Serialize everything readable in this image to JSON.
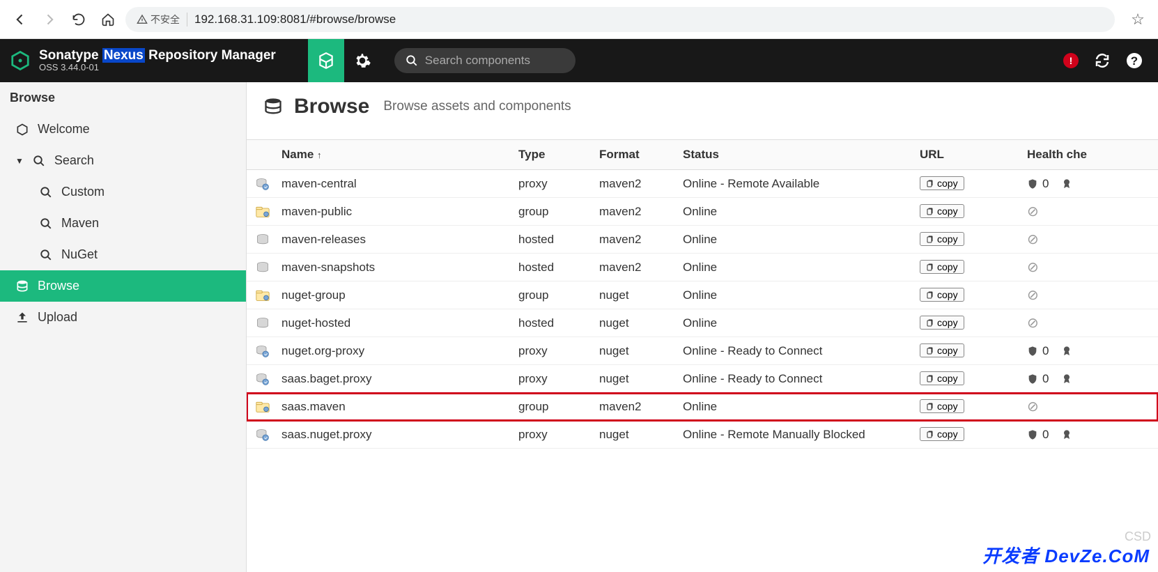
{
  "browser": {
    "insecure_label": "不安全",
    "url": "192.168.31.109:8081/#browse/browse"
  },
  "header": {
    "brand_pre": "Sonatype ",
    "brand_hl": "Nexus",
    "brand_post": " Repository Manager",
    "version": "OSS 3.44.0-01",
    "search_placeholder": "Search components"
  },
  "sidebar": {
    "header": "Browse",
    "items": [
      {
        "label": "Welcome",
        "icon": "hex"
      },
      {
        "label": "Search",
        "icon": "search",
        "caret": true
      },
      {
        "label": "Custom",
        "icon": "search",
        "indent": true
      },
      {
        "label": "Maven",
        "icon": "search",
        "indent": true
      },
      {
        "label": "NuGet",
        "icon": "search",
        "indent": true
      },
      {
        "label": "Browse",
        "icon": "db",
        "active": true
      },
      {
        "label": "Upload",
        "icon": "upload"
      }
    ]
  },
  "content": {
    "title": "Browse",
    "subtitle": "Browse assets and components"
  },
  "columns": {
    "name": "Name",
    "type": "Type",
    "format": "Format",
    "status": "Status",
    "url": "URL",
    "health": "Health che"
  },
  "copy_label": "copy",
  "rows": [
    {
      "name": "maven-central",
      "type": "proxy",
      "format": "maven2",
      "status": "Online - Remote Available",
      "kind": "proxy",
      "health": "shield0medal"
    },
    {
      "name": "maven-public",
      "type": "group",
      "format": "maven2",
      "status": "Online",
      "kind": "group",
      "health": "ban"
    },
    {
      "name": "maven-releases",
      "type": "hosted",
      "format": "maven2",
      "status": "Online",
      "kind": "hosted",
      "health": "ban"
    },
    {
      "name": "maven-snapshots",
      "type": "hosted",
      "format": "maven2",
      "status": "Online",
      "kind": "hosted",
      "health": "ban"
    },
    {
      "name": "nuget-group",
      "type": "group",
      "format": "nuget",
      "status": "Online",
      "kind": "group",
      "health": "ban"
    },
    {
      "name": "nuget-hosted",
      "type": "hosted",
      "format": "nuget",
      "status": "Online",
      "kind": "hosted",
      "health": "ban"
    },
    {
      "name": "nuget.org-proxy",
      "type": "proxy",
      "format": "nuget",
      "status": "Online - Ready to Connect",
      "kind": "proxy",
      "health": "shield0medal"
    },
    {
      "name": "saas.baget.proxy",
      "type": "proxy",
      "format": "nuget",
      "status": "Online - Ready to Connect",
      "kind": "proxy",
      "health": "shield0medal"
    },
    {
      "name": "saas.maven",
      "type": "group",
      "format": "maven2",
      "status": "Online",
      "kind": "group",
      "health": "ban",
      "highlight": true
    },
    {
      "name": "saas.nuget.proxy",
      "type": "proxy",
      "format": "nuget",
      "status": "Online - Remote Manually Blocked",
      "kind": "proxy",
      "health": "shield0medal"
    }
  ],
  "watermark": "开发者 DevZe.CoM",
  "csd": "CSD"
}
